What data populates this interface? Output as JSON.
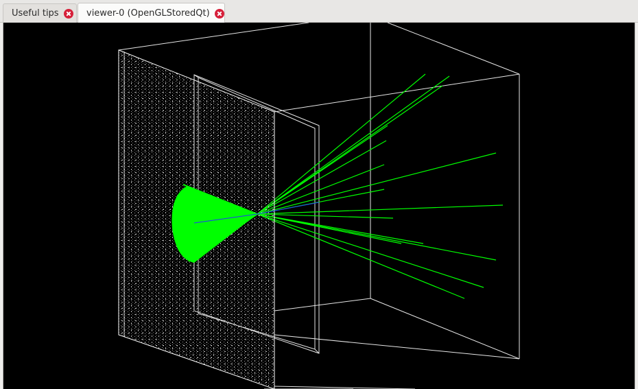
{
  "tabs": [
    {
      "label": "Useful tips",
      "active": false
    },
    {
      "label": "viewer-0 (OpenGLStoredQt)",
      "active": true
    }
  ],
  "viewer": {
    "background": "#000000",
    "wireframe_color": "#ffffff",
    "track_color": "#00ff00",
    "primary_track_color": "#1a2bff",
    "close_icon_color": "#d6203a"
  }
}
